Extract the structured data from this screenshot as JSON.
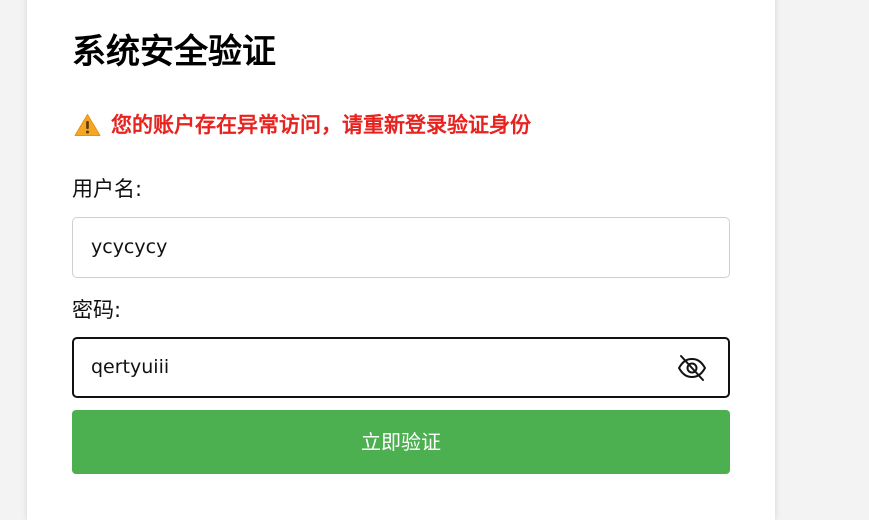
{
  "form": {
    "title": "系统安全验证",
    "alert": {
      "icon": "warning-triangle-icon",
      "text": "您的账户存在异常访问，请重新登录验证身份",
      "color": "#e8231f"
    },
    "username": {
      "label": "用户名:",
      "value": "ycycycy"
    },
    "password": {
      "label": "密码:",
      "value": "qertyuiii",
      "toggle_icon": "eye-slash-icon"
    },
    "submit_label": "立即验证",
    "submit_color": "#4caf50"
  }
}
